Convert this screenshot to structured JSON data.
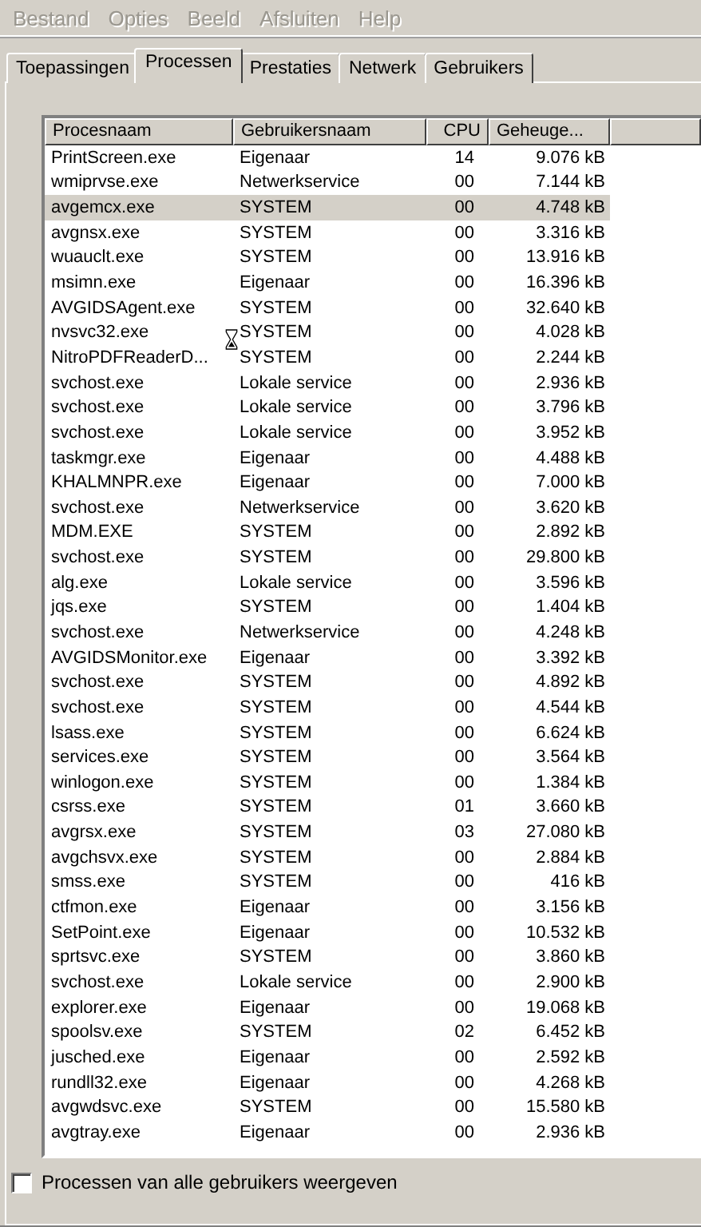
{
  "menu": [
    {
      "label": "Bestand",
      "disabled": true
    },
    {
      "label": "Opties",
      "disabled": true
    },
    {
      "label": "Beeld",
      "disabled": true
    },
    {
      "label": "Afsluiten",
      "disabled": true
    },
    {
      "label": "Help",
      "disabled": true
    }
  ],
  "tabs": [
    {
      "label": "Toepassingen",
      "selected": false
    },
    {
      "label": "Processen",
      "selected": true
    },
    {
      "label": "Prestaties",
      "selected": false
    },
    {
      "label": "Netwerk",
      "selected": false
    },
    {
      "label": "Gebruikers",
      "selected": false
    }
  ],
  "table": {
    "columns": [
      "Procesnaam",
      "Gebruikersnaam",
      "CPU",
      "Geheuge..."
    ],
    "rows": [
      {
        "cells": [
          "PrintScreen.exe",
          "Eigenaar",
          "14",
          "9.076 kB"
        ],
        "selected": false
      },
      {
        "cells": [
          "wmiprvse.exe",
          "Netwerkservice",
          "00",
          "7.144 kB"
        ],
        "selected": false
      },
      {
        "cells": [
          "avgemcx.exe",
          "SYSTEM",
          "00",
          "4.748 kB"
        ],
        "selected": true
      },
      {
        "cells": [
          "avgnsx.exe",
          "SYSTEM",
          "00",
          "3.316 kB"
        ],
        "selected": false
      },
      {
        "cells": [
          "wuauclt.exe",
          "SYSTEM",
          "00",
          "13.916 kB"
        ],
        "selected": false
      },
      {
        "cells": [
          "msimn.exe",
          "Eigenaar",
          "00",
          "16.396 kB"
        ],
        "selected": false
      },
      {
        "cells": [
          "AVGIDSAgent.exe",
          "SYSTEM",
          "00",
          "32.640 kB"
        ],
        "selected": false
      },
      {
        "cells": [
          "nvsvc32.exe",
          "SYSTEM",
          "00",
          "4.028 kB"
        ],
        "selected": false
      },
      {
        "cells": [
          "NitroPDFReaderD...",
          "SYSTEM",
          "00",
          "2.244 kB"
        ],
        "selected": false
      },
      {
        "cells": [
          "svchost.exe",
          "Lokale service",
          "00",
          "2.936 kB"
        ],
        "selected": false
      },
      {
        "cells": [
          "svchost.exe",
          "Lokale service",
          "00",
          "3.796 kB"
        ],
        "selected": false
      },
      {
        "cells": [
          "svchost.exe",
          "Lokale service",
          "00",
          "3.952 kB"
        ],
        "selected": false
      },
      {
        "cells": [
          "taskmgr.exe",
          "Eigenaar",
          "00",
          "4.488 kB"
        ],
        "selected": false
      },
      {
        "cells": [
          "KHALMNPR.exe",
          "Eigenaar",
          "00",
          "7.000 kB"
        ],
        "selected": false
      },
      {
        "cells": [
          "svchost.exe",
          "Netwerkservice",
          "00",
          "3.620 kB"
        ],
        "selected": false
      },
      {
        "cells": [
          "MDM.EXE",
          "SYSTEM",
          "00",
          "2.892 kB"
        ],
        "selected": false
      },
      {
        "cells": [
          "svchost.exe",
          "SYSTEM",
          "00",
          "29.800 kB"
        ],
        "selected": false
      },
      {
        "cells": [
          "alg.exe",
          "Lokale service",
          "00",
          "3.596 kB"
        ],
        "selected": false
      },
      {
        "cells": [
          "jqs.exe",
          "SYSTEM",
          "00",
          "1.404 kB"
        ],
        "selected": false
      },
      {
        "cells": [
          "svchost.exe",
          "Netwerkservice",
          "00",
          "4.248 kB"
        ],
        "selected": false
      },
      {
        "cells": [
          "AVGIDSMonitor.exe",
          "Eigenaar",
          "00",
          "3.392 kB"
        ],
        "selected": false
      },
      {
        "cells": [
          "svchost.exe",
          "SYSTEM",
          "00",
          "4.892 kB"
        ],
        "selected": false
      },
      {
        "cells": [
          "svchost.exe",
          "SYSTEM",
          "00",
          "4.544 kB"
        ],
        "selected": false
      },
      {
        "cells": [
          "lsass.exe",
          "SYSTEM",
          "00",
          "6.624 kB"
        ],
        "selected": false
      },
      {
        "cells": [
          "services.exe",
          "SYSTEM",
          "00",
          "3.564 kB"
        ],
        "selected": false
      },
      {
        "cells": [
          "winlogon.exe",
          "SYSTEM",
          "00",
          "1.384 kB"
        ],
        "selected": false
      },
      {
        "cells": [
          "csrss.exe",
          "SYSTEM",
          "01",
          "3.660 kB"
        ],
        "selected": false
      },
      {
        "cells": [
          "avgrsx.exe",
          "SYSTEM",
          "03",
          "27.080 kB"
        ],
        "selected": false
      },
      {
        "cells": [
          "avgchsvx.exe",
          "SYSTEM",
          "00",
          "2.884 kB"
        ],
        "selected": false
      },
      {
        "cells": [
          "smss.exe",
          "SYSTEM",
          "00",
          "416 kB"
        ],
        "selected": false
      },
      {
        "cells": [
          "ctfmon.exe",
          "Eigenaar",
          "00",
          "3.156 kB"
        ],
        "selected": false
      },
      {
        "cells": [
          "SetPoint.exe",
          "Eigenaar",
          "00",
          "10.532 kB"
        ],
        "selected": false
      },
      {
        "cells": [
          "sprtsvc.exe",
          "SYSTEM",
          "00",
          "3.860 kB"
        ],
        "selected": false
      },
      {
        "cells": [
          "svchost.exe",
          "Lokale service",
          "00",
          "2.900 kB"
        ],
        "selected": false
      },
      {
        "cells": [
          "explorer.exe",
          "Eigenaar",
          "00",
          "19.068 kB"
        ],
        "selected": false
      },
      {
        "cells": [
          "spoolsv.exe",
          "SYSTEM",
          "02",
          "6.452 kB"
        ],
        "selected": false
      },
      {
        "cells": [
          "jusched.exe",
          "Eigenaar",
          "00",
          "2.592 kB"
        ],
        "selected": false
      },
      {
        "cells": [
          "rundll32.exe",
          "Eigenaar",
          "00",
          "4.268 kB"
        ],
        "selected": false
      },
      {
        "cells": [
          "avgwdsvc.exe",
          "SYSTEM",
          "00",
          "15.580 kB"
        ],
        "selected": false
      },
      {
        "cells": [
          "avgtray.exe",
          "Eigenaar",
          "00",
          "2.936 kB"
        ],
        "selected": false
      }
    ]
  },
  "show_all": {
    "label": "Processen van alle gebruikers weergeven",
    "checked": false
  }
}
